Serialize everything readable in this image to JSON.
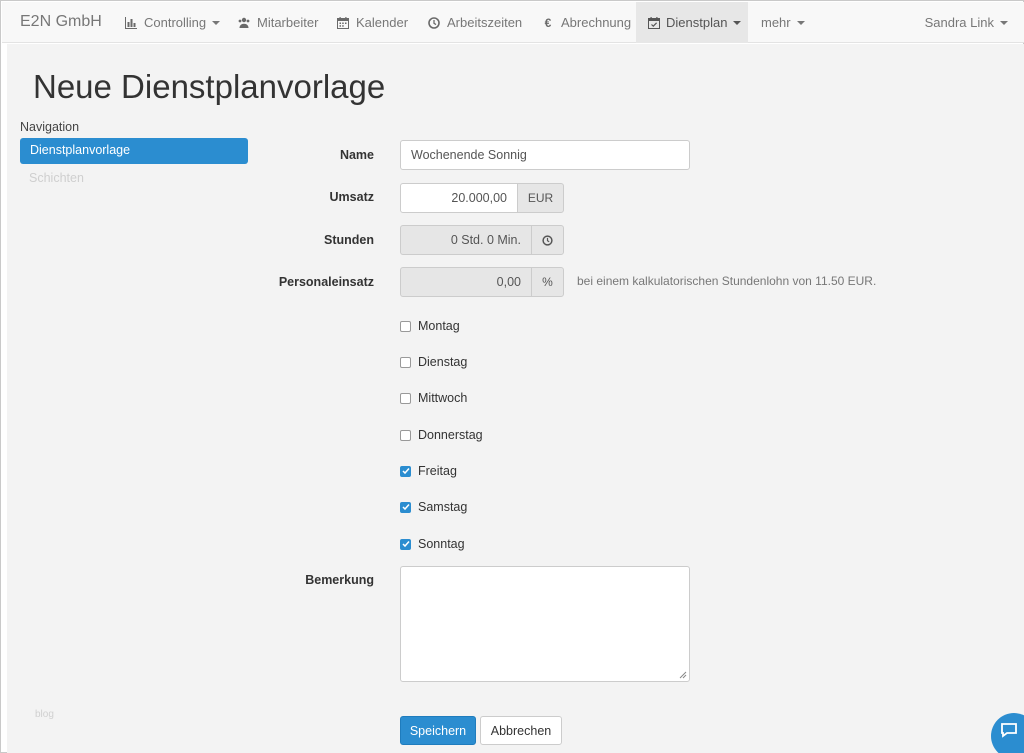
{
  "navbar": {
    "brand": "E2N GmbH",
    "items": [
      {
        "label": "Controlling",
        "icon": "bar-chart-icon",
        "dropdown": true
      },
      {
        "label": "Mitarbeiter",
        "icon": "users-icon",
        "dropdown": false
      },
      {
        "label": "Kalender",
        "icon": "calendar-icon",
        "dropdown": false
      },
      {
        "label": "Arbeitszeiten",
        "icon": "clock-icon",
        "dropdown": false
      },
      {
        "label": "Abrechnung",
        "icon": "euro-icon",
        "dropdown": false
      },
      {
        "label": "Dienstplan",
        "icon": "calendar-check-icon",
        "dropdown": true,
        "active": true
      },
      {
        "label": "mehr",
        "dropdown": true
      }
    ],
    "user": "Sandra Link"
  },
  "page": {
    "title": "Neue Dienstplanvorlage"
  },
  "sidebar": {
    "heading": "Navigation",
    "items": [
      {
        "label": "Dienstplanvorlage",
        "active": true
      },
      {
        "label": "Schichten",
        "active": false
      }
    ],
    "footer": "blog"
  },
  "form": {
    "name": {
      "label": "Name",
      "value": "Wochenende Sonnig"
    },
    "umsatz": {
      "label": "Umsatz",
      "value": "20.000,00",
      "addon": "EUR"
    },
    "stunden": {
      "label": "Stunden",
      "value": "0 Std. 0 Min.",
      "addon_icon": "clock-icon"
    },
    "personaleinsatz": {
      "label": "Personaleinsatz",
      "value": "0,00",
      "addon": "%",
      "help": "bei einem kalkulatorischen Stundenlohn von 11.50 EUR."
    },
    "days": [
      {
        "label": "Montag",
        "checked": false
      },
      {
        "label": "Dienstag",
        "checked": false
      },
      {
        "label": "Mittwoch",
        "checked": false
      },
      {
        "label": "Donnerstag",
        "checked": false
      },
      {
        "label": "Freitag",
        "checked": true
      },
      {
        "label": "Samstag",
        "checked": true
      },
      {
        "label": "Sonntag",
        "checked": true
      }
    ],
    "bemerkung": {
      "label": "Bemerkung",
      "value": ""
    },
    "save_label": "Speichern",
    "cancel_label": "Abbrechen"
  },
  "colors": {
    "primary": "#2b8dd0",
    "navbar_bg": "#f8f8f8",
    "content_bg": "#f3f3f3"
  }
}
